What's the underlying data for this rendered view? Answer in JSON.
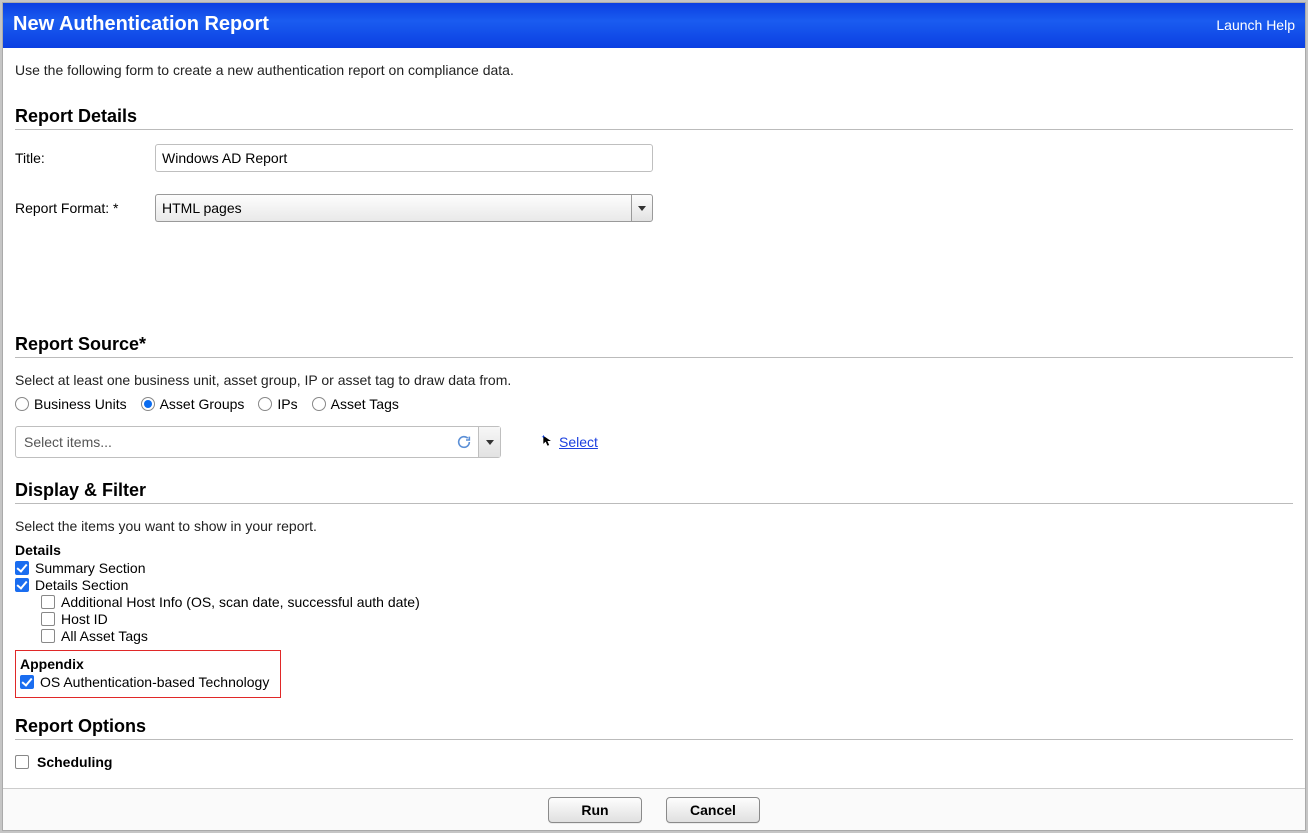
{
  "header": {
    "title": "New Authentication Report",
    "help": "Launch Help"
  },
  "intro": "Use the following form to create a new authentication report on compliance data.",
  "sections": {
    "details_head": "Report Details",
    "source_head": "Report Source*",
    "display_head": "Display & Filter",
    "options_head": "Report Options"
  },
  "details": {
    "title_label": "Title:",
    "title_value": "Windows AD Report",
    "format_label": "Report Format: *",
    "format_value": "HTML pages"
  },
  "source": {
    "subtext": "Select at least one business unit, asset group, IP or asset tag to draw data from.",
    "radios": {
      "bu": "Business Units",
      "ag": "Asset Groups",
      "ips": "IPs",
      "tags": "Asset Tags"
    },
    "selected_radio": "ag",
    "multi_placeholder": "Select items...",
    "select_link": "Select"
  },
  "display": {
    "subtext": "Select the items you want to show in your report.",
    "details_head": "Details",
    "summary": "Summary Section",
    "details_sec": "Details Section",
    "addl": "Additional Host Info (OS, scan date, successful auth date)",
    "hostid": "Host ID",
    "alltags": "All Asset Tags",
    "appendix_head": "Appendix",
    "osauth": "OS Authentication-based Technology"
  },
  "options": {
    "sched": "Scheduling"
  },
  "footer": {
    "run": "Run",
    "cancel": "Cancel"
  }
}
